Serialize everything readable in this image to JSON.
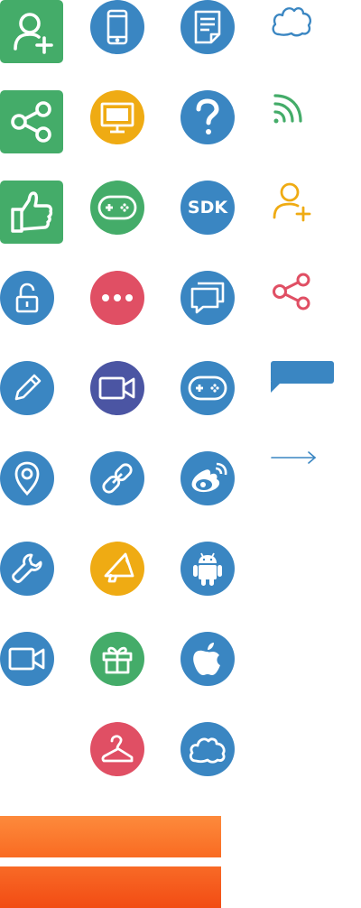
{
  "colors": {
    "green": "#44ac69",
    "blue": "#3a86c2",
    "orange": "#efab13",
    "red": "#e04f64",
    "indigo": "#4b55a3",
    "bar_top": "#fc7b30",
    "bar_bottom": "#f4531b"
  },
  "icons": {
    "col1": [
      "add-user-icon",
      "share-icon",
      "thumbs-up-icon",
      "unlock-icon",
      "pencil-icon",
      "location-pin-icon",
      "wrench-icon",
      "video-camera-icon"
    ],
    "col2": [
      "smartphone-icon",
      "monitor-icon",
      "gamepad-icon",
      "more-dots-icon",
      "video-camera-icon",
      "link-icon",
      "megaphone-icon",
      "gift-icon",
      "hanger-icon"
    ],
    "col3": [
      "document-icon",
      "question-icon",
      "sdk-icon",
      "chat-bubbles-icon",
      "gamepad-icon",
      "weibo-icon",
      "android-icon",
      "apple-icon",
      "cloud-icon"
    ],
    "col4": [
      "cloud-outline-icon",
      "rss-icon",
      "add-user-outline-icon",
      "share-outline-icon",
      "speech-bubble-icon",
      "arrow-right-icon"
    ]
  },
  "labels": {
    "sdk": "SDK"
  }
}
